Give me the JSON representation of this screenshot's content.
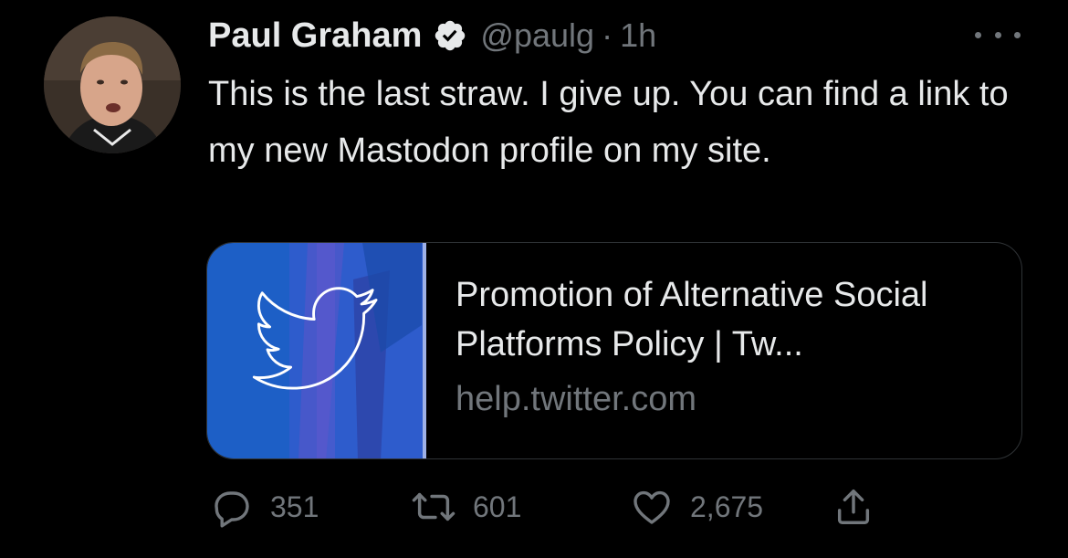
{
  "tweet": {
    "author_name": "Paul Graham",
    "handle": "@paulg",
    "separator": "·",
    "time": "1h",
    "text": "This is the last straw. I give up. You can find a link to my new Mastodon profile on my site.",
    "verified": true
  },
  "card": {
    "title": "Promotion of Alternative Social Platforms Policy | Tw...",
    "domain": "help.twitter.com",
    "image_icon": "twitter-bird-icon"
  },
  "actions": {
    "reply_count": "351",
    "retweet_count": "601",
    "like_count": "2,675"
  },
  "colors": {
    "background": "#000000",
    "primary_text": "#e7e9ea",
    "secondary_text": "#71767b",
    "verified_badge": "#e7e9ea",
    "card_border": "#2f3336",
    "card_image_blue": "#1d5fc6"
  }
}
